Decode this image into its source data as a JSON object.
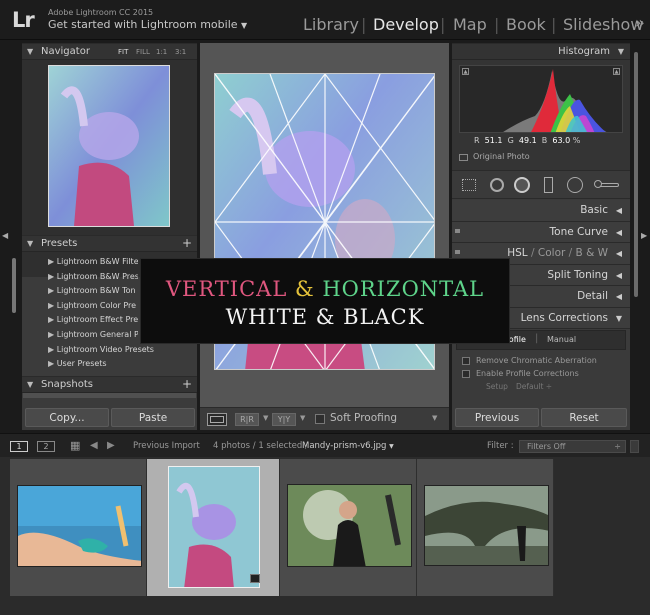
{
  "header": {
    "logo": "Lr",
    "app_name": "Adobe Lightroom CC 2015",
    "mobile_link": "Get started with Lightroom mobile",
    "modules": [
      "Library",
      "Develop",
      "Map",
      "Book",
      "Slideshow"
    ],
    "more": "»"
  },
  "navigator": {
    "title": "Navigator",
    "zoom_options": [
      "FIT",
      "FILL",
      "1:1",
      "3:1"
    ]
  },
  "presets": {
    "title": "Presets",
    "add": "+",
    "items": [
      "Lightroom B&W Filter",
      "Lightroom B&W Pres",
      "Lightroom B&W Ton",
      "Lightroom Color Pre",
      "Lightroom Effect Pre",
      "Lightroom General P",
      "Lightroom Video Presets",
      "User Presets"
    ]
  },
  "snapshots": {
    "title": "Snapshots",
    "add": "+"
  },
  "left_buttons": {
    "copy": "Copy...",
    "paste": "Paste"
  },
  "histogram": {
    "title": "Histogram",
    "r_label": "R",
    "r_value": "51.1",
    "g_label": "G",
    "g_value": "49.1",
    "b_label": "B",
    "b_value": "63.0",
    "unit": "%",
    "original_photo": "Original Photo"
  },
  "right_sections": {
    "basic": "Basic",
    "tone_curve": "Tone Curve",
    "hsl": "HSL",
    "hsl_sep1": "/",
    "color": "Color",
    "hsl_sep2": "/",
    "bw": "B & W",
    "split_toning": "Split Toning",
    "detail": "Detail",
    "lens_corrections": "Lens Corrections"
  },
  "lens": {
    "tab_profile": "Profile",
    "tab_manual": "Manual",
    "chromatic": "Remove Chromatic Aberration",
    "profile_corr": "Enable Profile Corrections",
    "setup_label": "Setup",
    "setup_value": "Default"
  },
  "right_buttons": {
    "previous": "Previous",
    "reset": "Reset"
  },
  "toolbar": {
    "soft_proofing": "Soft Proofing",
    "rr": "R|R",
    "yy": "Y|Y"
  },
  "filmstrip_bar": {
    "screen1": "1",
    "screen2": "2",
    "source": "Previous Import",
    "count": "4 photos / 1 selected /",
    "filename": "Mandy-prism-v6.jpg",
    "filter_label": "Filter :",
    "filter_value": "Filters Off"
  },
  "overlay": {
    "vertical": "VERTICAL",
    "amp": "&",
    "horizontal": "HORIZONTAL",
    "line2": "WHITE & BLACK",
    "colors": {
      "vertical": "#e0577f",
      "amp": "#e5c33b",
      "horizontal": "#5ed48a"
    }
  },
  "colors": {
    "accent": "#e6e6e6",
    "panel": "#3b3b3b",
    "bg": "#1b1b1b"
  }
}
